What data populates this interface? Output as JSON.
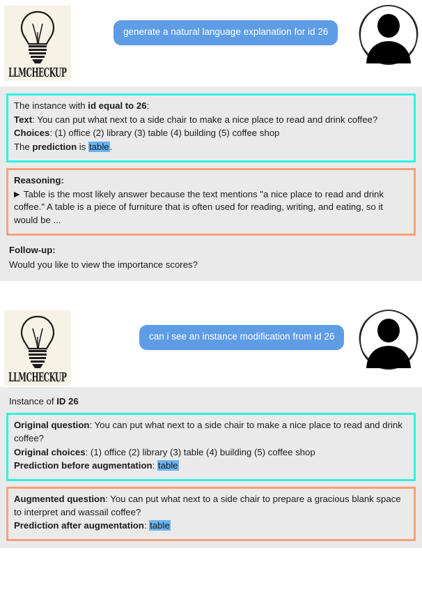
{
  "app": {
    "logo_word": "LLMCHECKUP",
    "logo_icon": "lightbulb-icon",
    "avatar_icon": "user-avatar-icon",
    "accent_blue": "#5e9ce6",
    "accent_cyan": "#2ef2e0",
    "accent_orange": "#f7a177",
    "highlight_blue": "#6cb3ee",
    "panel_gray": "#eaeaea",
    "logo_bg": "#f6f2e6"
  },
  "turns": [
    {
      "user_message": "generate a natural language explanation for id 26",
      "instance_box": {
        "l1_prefix": "The instance with ",
        "l1_bold": "id equal to 26",
        "l1_suffix": ":",
        "l2_label": "Text",
        "l2_text": ": You can put what next to a side chair to make a nice place to read and drink coffee?",
        "l3_label": "Choices",
        "l3_text": ": (1) office (2) library (3) table (4) building (5) coffee shop",
        "l4_prefix": "The ",
        "l4_bold": "prediction",
        "l4_mid": " is ",
        "l4_highlight": "table",
        "l4_suffix": "."
      },
      "reasoning_box": {
        "heading": "Reasoning:",
        "bullet": "▶",
        "text": "Table is the most likely answer because the text mentions \"a nice place to read and drink coffee.\" A table is a piece of furniture that is often used for reading, writing, and eating, so it would be ..."
      },
      "followup": {
        "heading": "Follow-up:",
        "text": "Would you like to view the importance scores?"
      }
    },
    {
      "user_message": "can i see an instance modification from id 26",
      "instance_title_prefix": "Instance of ",
      "instance_title_bold": "ID 26",
      "original_box": {
        "l1_label": "Original question",
        "l1_text": ": You can put what next to a side chair to make a nice place to read and drink coffee?",
        "l2_label": "Original choices",
        "l2_text": ": (1) office (2) library (3) table (4) building (5) coffee shop",
        "l3_label": "Prediction before augmentation",
        "l3_mid": ": ",
        "l3_highlight": "table"
      },
      "augmented_box": {
        "l1_label": "Augmented question",
        "l1_text": ": You can put what next to a side chair to prepare a gracious blank space to interpret and wassail coffee?",
        "l2_label": "Prediction after augmentation",
        "l2_mid": ": ",
        "l2_highlight": "table"
      }
    }
  ]
}
